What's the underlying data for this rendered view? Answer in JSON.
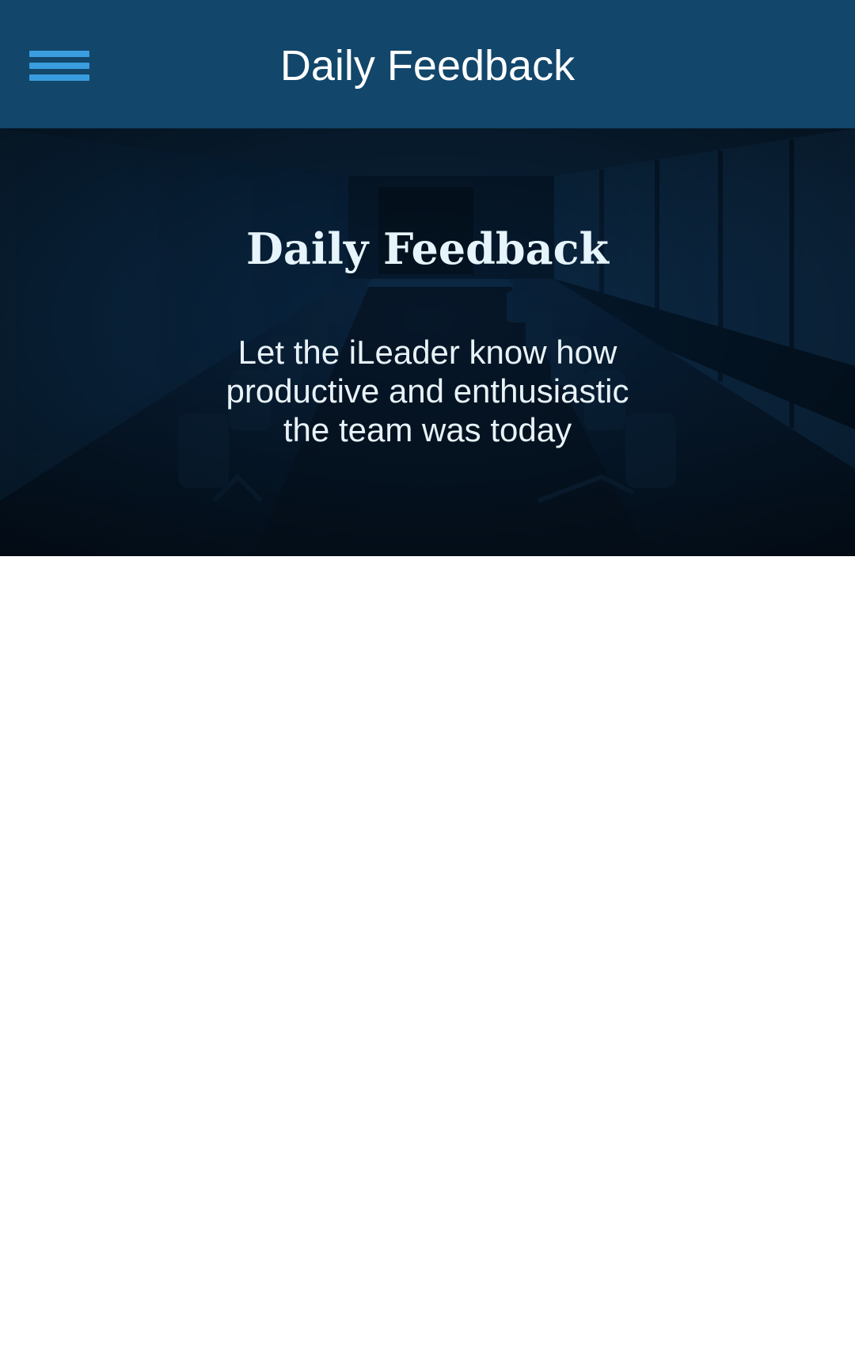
{
  "app_bar": {
    "title": "Daily Feedback",
    "menu_icon": "hamburger-menu-icon",
    "background_color": "#12466a",
    "menu_icon_color": "#3a9de0"
  },
  "hero": {
    "title": "Daily Feedback",
    "subtitle": "Let the iLeader know how productive and enthusiastic the team was today",
    "background_image": "conference-room-photo"
  }
}
